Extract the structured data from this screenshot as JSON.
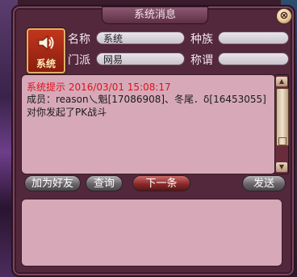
{
  "window": {
    "title": "系统消息",
    "close_label": "⊗"
  },
  "sender": {
    "icon_label": "系统",
    "name_label": "名称",
    "name_value": "系统",
    "race_label": "种族",
    "race_value": "",
    "sect_label": "门派",
    "sect_value": "网易",
    "title_label": "称谓",
    "title_value": ""
  },
  "message": {
    "header": "系统提示 2016/03/01 15:08:17",
    "body": "成员：reason乀魁[17086908]、冬尾．δ[16453055]对你发起了PK战斗"
  },
  "buttons": {
    "add_friend": "加为好友",
    "inquire": "查询",
    "next": "下一条",
    "send": "发送"
  },
  "input": {
    "value": ""
  },
  "colors": {
    "header_red": "#e0101c",
    "panel_pink": "#d7a9b8",
    "frame": "#53283c"
  }
}
